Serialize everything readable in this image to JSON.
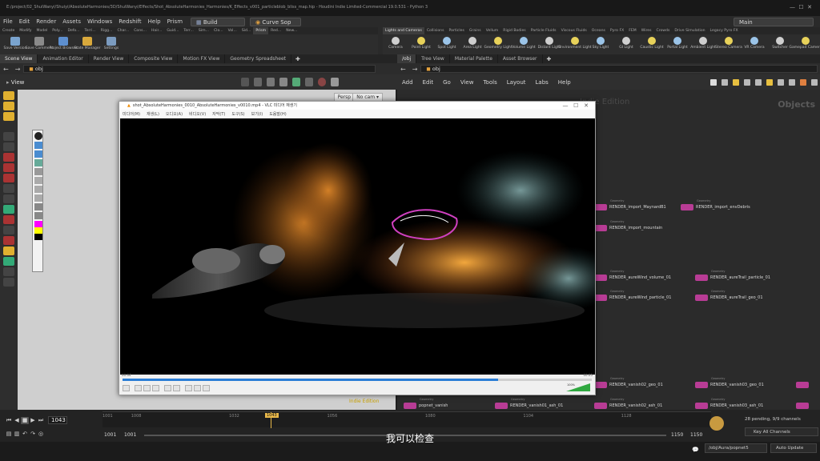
{
  "window": {
    "title": "E:/project/02_ShuiWanyi/Shuiyi/AbsoluteHarmonies/3D/ShuiWanyi/Effects/Shot_AbsoluteHarmonies_Harmonies/K_Effects_v001_particleblob_bliss_map.hip - Houdini Indie Limited-Commercial 19.0.531 - Python 3"
  },
  "menubar": {
    "items": [
      "File",
      "Edit",
      "Render",
      "Assets",
      "Windows",
      "Redshift",
      "Help",
      "Prism"
    ],
    "desktop": "Build",
    "curve_tool": "Curve Sop",
    "main": "Main"
  },
  "shelf_left": {
    "tabs": [
      "Create",
      "Modify",
      "Model",
      "Poly...",
      "Defo...",
      "Terri...",
      "Rigg...",
      "Char...",
      "Cons...",
      "Hair...",
      "Guid...",
      "Terr...",
      "Sim...",
      "Clo...",
      "Vol...",
      "Sid...",
      "Prism",
      "Red...",
      "New..."
    ],
    "active_tab": "Prism",
    "tools": [
      "Save Version",
      "Save Comment",
      "Project Browser",
      "State Manager",
      "Settings"
    ]
  },
  "shelf_right": {
    "tabs": [
      "Lights and Cameras",
      "Collisions",
      "Particles",
      "Grains",
      "Vellum",
      "Rigid Bodies",
      "Particle Fluids",
      "Viscous Fluids",
      "Oceans",
      "Pyro FX",
      "FEM",
      "Wires",
      "Crowds",
      "Drive Simulation",
      "Legacy Pyro FX"
    ],
    "active_tab": "Lights and Cameras",
    "tools": [
      "Camera",
      "Point Light",
      "Spot Light",
      "Area Light",
      "Geometry Light",
      "Volume Light",
      "Distant Light",
      "Environment Light",
      "Sky Light",
      "GI Light",
      "Caustic Light",
      "Portal Light",
      "Ambient Light",
      "Stereo Camera",
      "VR Camera",
      "Switcher",
      "Gamepad Camera"
    ]
  },
  "left_panes": {
    "tabs": [
      "Scene View",
      "Animation Editor",
      "Render View",
      "Composite View",
      "Motion FX View",
      "Geometry Spreadsheet"
    ],
    "path": "obj",
    "view_label": "View",
    "persp": "Persp",
    "cam": "No cam",
    "indie_edition": "Indie Edition"
  },
  "right_panes": {
    "tabs": [
      "/obj",
      "Tree View",
      "Material Palette",
      "Asset Browser"
    ],
    "path": "obj",
    "menu": [
      "Add",
      "Edit",
      "Go",
      "View",
      "Tools",
      "Layout",
      "Labs",
      "Help"
    ],
    "watermark": "Indie Edition",
    "context_label": "Objects"
  },
  "player": {
    "title": "shot_AbsoluteHarmonies_0010_AbsoluteHarmonies_v0010.mp4 - VLC 미디어 재생기",
    "menu": [
      "미디어(M)",
      "재생(L)",
      "오디오(A)",
      "비디오(V)",
      "자막(T)",
      "도구(S)",
      "보기(I)",
      "도움말(H)"
    ],
    "time_current": "00:04",
    "time_total": "00:05",
    "progress": 0.8,
    "volume": "100%"
  },
  "nodes": [
    {
      "type": "Geometry",
      "name": "RENDER_import_MaynardB1"
    },
    {
      "type": "Geometry",
      "name": "RENDER_import_envDebris"
    },
    {
      "type": "Geometry",
      "name": "RENDER_import_mountain"
    },
    {
      "type": "Geometry",
      "name": "RENDER_aureWind_volume_01"
    },
    {
      "type": "Geometry",
      "name": "RENDER_aureTrail_particle_01"
    },
    {
      "type": "Geometry",
      "name": "RENDER_aureWind_particle_01"
    },
    {
      "type": "Geometry",
      "name": "RENDER_aureTrail_geo_01"
    },
    {
      "type": "Geometry",
      "name": "RENDER_vanish02_geo_01"
    },
    {
      "type": "Geometry",
      "name": "RENDER_vanish03_geo_01"
    },
    {
      "type": "Geometry",
      "name": "popnet_vanish"
    },
    {
      "type": "Geometry",
      "name": "RENDER_vanish01_ash_01"
    },
    {
      "type": "Geometry",
      "name": "RENDER_vanish02_ash_01"
    },
    {
      "type": "Geometry",
      "name": "RENDER_vanish03_ash_01"
    }
  ],
  "timeline": {
    "current_frame": "1043",
    "ticks": [
      "1001",
      "1008",
      "1032",
      "1043",
      "1056",
      "1080",
      "1104",
      "1128"
    ],
    "range_start": "1001",
    "range_start2": "1001",
    "range_end": "1150",
    "range_end2": "1150",
    "pending": "28 pending, 9/9 channels",
    "channels": "Key All Channels",
    "status_path": "/obj/Aura/popnet5",
    "auto_update": "Auto Update"
  },
  "subtitle": "我可以检查",
  "colors": {
    "accent_node": "#b83c95",
    "seek": "#2a7dd6",
    "keyframe": "#e8b84a"
  }
}
